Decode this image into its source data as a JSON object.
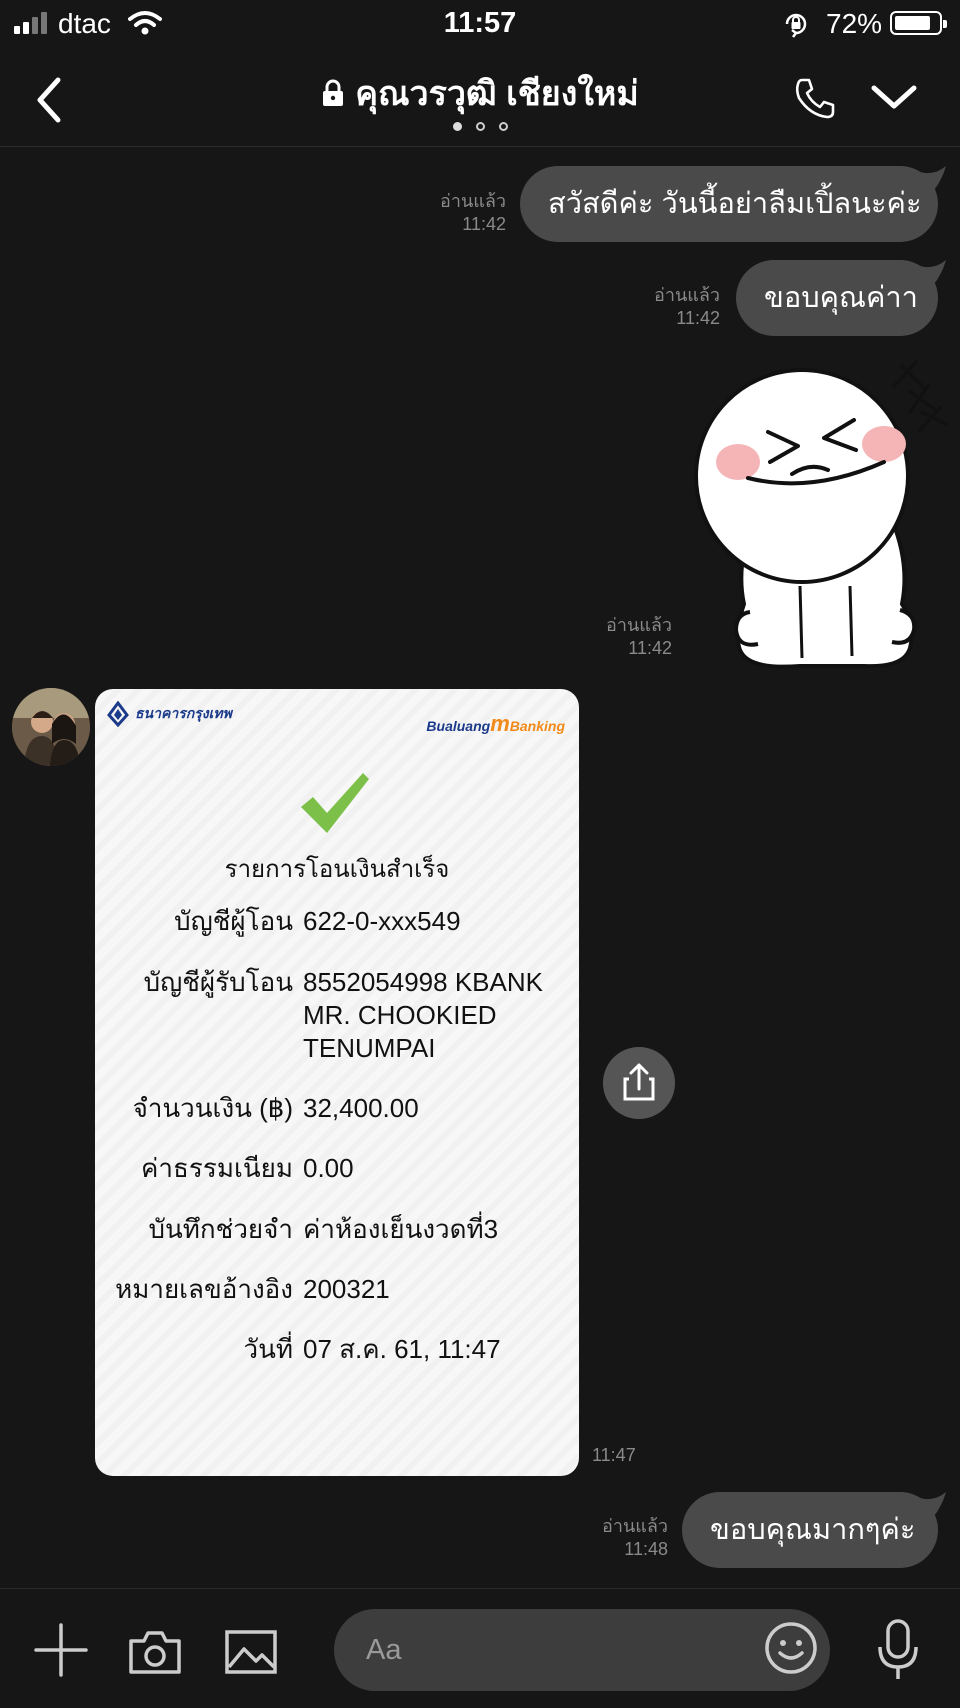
{
  "status_bar": {
    "carrier": "dtac",
    "time": "11:57",
    "battery": "72%",
    "battery_level": 0.72
  },
  "header": {
    "title": "คุณวรวุฒิ เชียงใหม่",
    "page_dots": 3,
    "active_dot": 1
  },
  "messages": {
    "m1": {
      "text": "สวัสดีค่ะ วันนี้อย่าลืมเปิ้ลนะค่ะ",
      "read": "อ่านแล้ว",
      "time": "11:42"
    },
    "m2": {
      "text": "ขอบคุณค่าา",
      "read": "อ่านแล้ว",
      "time": "11:42"
    },
    "sticker": {
      "read": "อ่านแล้ว",
      "time": "11:42"
    },
    "receipt": {
      "bank_name": "ธนาคารกรุงเทพ",
      "app_name_prefix": "Bualuang",
      "app_name_m": "m",
      "app_name_suffix": "Banking",
      "title": "รายการโอนเงินสำเร็จ",
      "from_label": "บัญชีผู้โอน",
      "from_value": "622-0-xxx549",
      "to_label": "บัญชีผู้รับโอน",
      "to_value_1": "8552054998 KBANK",
      "to_value_2": "MR. CHOOKIED",
      "to_value_3": "TENUMPAI",
      "amount_label": "จำนวนเงิน (฿)",
      "amount_value": "32,400.00",
      "fee_label": "ค่าธรรมเนียม",
      "fee_value": "0.00",
      "memo_label": "บันทึกช่วยจำ",
      "memo_value": "ค่าห้องเย็นงวดที่3",
      "ref_label": "หมายเลขอ้างอิง",
      "ref_value": "200321",
      "date_label": "วันที่",
      "date_value": "07 ส.ค. 61, 11:47",
      "time": "11:47"
    },
    "m3": {
      "text": "ขอบคุณมากๆค่ะ",
      "read": "อ่านแล้ว",
      "time": "11:48"
    }
  },
  "composer": {
    "placeholder": "Aa"
  },
  "colors": {
    "background": "#161616",
    "bubble": "#4a4a4a",
    "meta_text": "#8a8a8a",
    "check_green": "#7cc04a",
    "bank_blue": "#1b3a8a",
    "mbanking_orange": "#f28a1a"
  },
  "icons": [
    "signal-icon",
    "wifi-icon",
    "rotation-lock-icon",
    "battery-icon",
    "back-icon",
    "lock-icon",
    "phone-icon",
    "chevron-down-icon",
    "share-icon",
    "plus-icon",
    "camera-icon",
    "image-icon",
    "emoji-icon",
    "mic-icon"
  ]
}
